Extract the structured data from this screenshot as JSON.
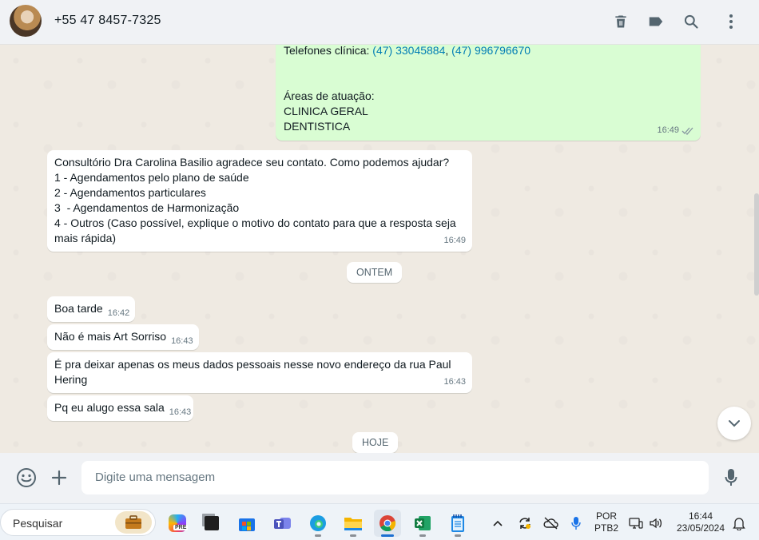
{
  "header": {
    "contact_name": "+55 47 8457-7325",
    "icons": [
      "delete-icon",
      "label-icon",
      "search-icon",
      "menu-icon"
    ]
  },
  "messages": {
    "m1": {
      "phones_prefix": "Telefones clínica: ",
      "phone1": "(47) 33045884",
      "phone_sep": ", ",
      "phone2": "(47) 996796670",
      "areas_label": "Áreas de atuação:",
      "area1": "CLINICA GERAL",
      "area2": "DENTISTICA",
      "time": "16:49"
    },
    "m2": {
      "lines": [
        "Consultório Dra Carolina Basilio agradece seu contato. Como podemos ajudar?",
        "1 - Agendamentos pelo plano de saúde",
        "2 - Agendamentos particulares",
        "3  - Agendamentos de Harmonização",
        "4 - Outros (Caso possível, explique o motivo do contato para que a resposta seja",
        "mais rápida)"
      ],
      "time": "16:49"
    },
    "day_ontem": "ONTEM",
    "m3": {
      "text": "Boa tarde",
      "time": "16:42"
    },
    "m4": {
      "text": "Não é mais Art Sorriso",
      "time": "16:43"
    },
    "m5": {
      "lines": [
        "É pra deixar apenas os meus dados pessoais nesse novo endereço da rua Paul",
        "Hering"
      ],
      "time": "16:43"
    },
    "m6": {
      "text": "Pq eu alugo essa sala",
      "time": "16:43"
    },
    "day_hoje": "HOJE"
  },
  "compose": {
    "placeholder": "Digite uma mensagem"
  },
  "taskbar": {
    "search_label": "Pesquisar",
    "copilot_badge": "PRE",
    "language": "POR",
    "keyboard": "PTB2",
    "clock_time": "16:44",
    "clock_date": "23/05/2024"
  },
  "colors": {
    "incoming_bubble": "#ffffff",
    "outgoing_bubble": "#d9fdd3",
    "chat_bg": "#efeae2",
    "link": "#027eb5"
  }
}
